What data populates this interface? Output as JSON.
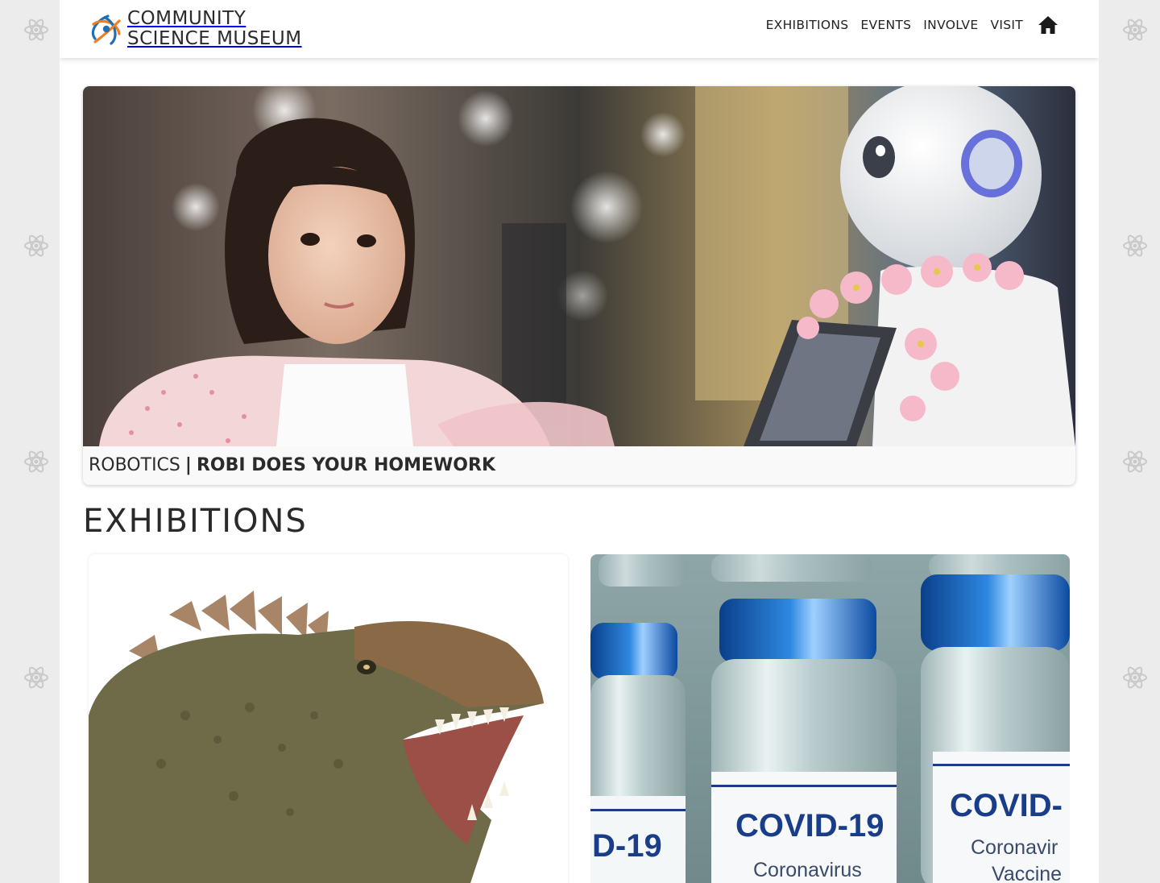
{
  "site": {
    "logo_line1": "COMMUNITY",
    "logo_line2": "SCIENCE MUSEUM"
  },
  "nav": {
    "items": [
      {
        "label": "EXHIBITIONS"
      },
      {
        "label": "EVENTS"
      },
      {
        "label": "INVOLVE"
      },
      {
        "label": "VISIT"
      }
    ],
    "home_icon": "home-icon"
  },
  "hero": {
    "category": "ROBOTICS",
    "separator": "|",
    "title": "ROBI DOES YOUR HOMEWORK",
    "image": "child-and-humanoid-robot-photo"
  },
  "exhibitions": {
    "heading": "EXHIBITIONS",
    "cards": [
      {
        "image": "dinosaur-head-photo"
      },
      {
        "image": "covid-vaccine-vials-photo",
        "vial_labels": {
          "left": "D-19",
          "center_main": "COVID-19",
          "center_sub": "Coronavirus",
          "right_main": "COVID-",
          "right_sub1": "Coronavir",
          "right_sub2": "Vaccine"
        }
      }
    ]
  },
  "colors": {
    "background": "#ececec",
    "page": "#ffffff",
    "text": "#2b2b2b",
    "logo_blue": "#1f6fb7",
    "logo_orange": "#ef7d22"
  },
  "icons": {
    "side_decoration": "atom-icon"
  }
}
